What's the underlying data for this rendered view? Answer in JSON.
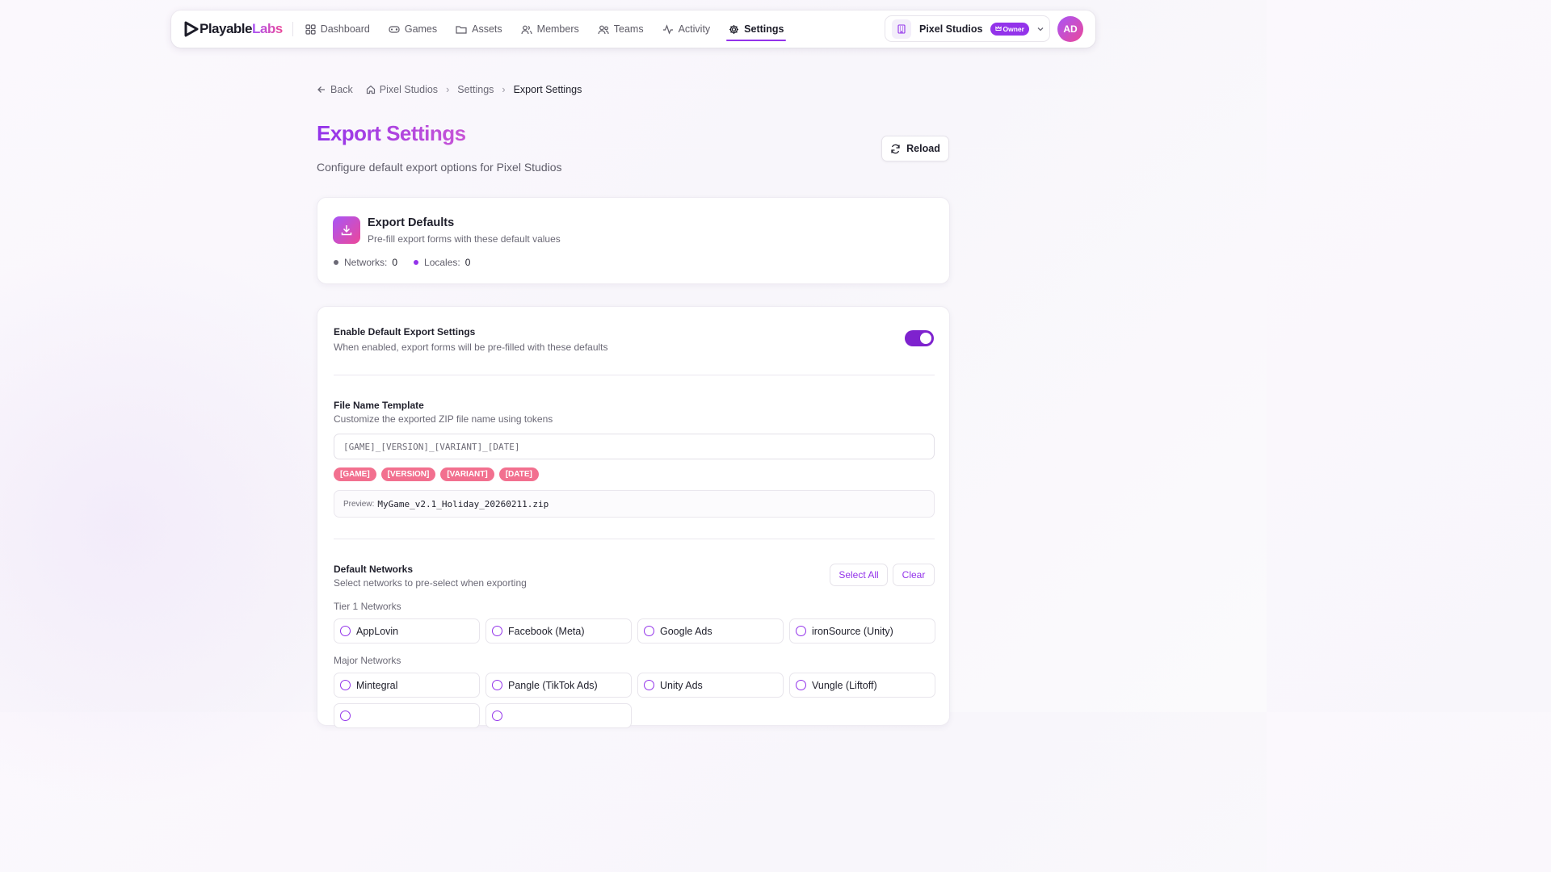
{
  "brand": {
    "part1": "Playable",
    "part2": "Labs"
  },
  "nav": {
    "items": [
      {
        "label": "Dashboard",
        "icon": "dashboard-icon",
        "active": false
      },
      {
        "label": "Games",
        "icon": "gamepad-icon",
        "active": false
      },
      {
        "label": "Assets",
        "icon": "folder-icon",
        "active": false
      },
      {
        "label": "Members",
        "icon": "members-icon",
        "active": false
      },
      {
        "label": "Teams",
        "icon": "teams-icon",
        "active": false
      },
      {
        "label": "Activity",
        "icon": "activity-icon",
        "active": false
      },
      {
        "label": "Settings",
        "icon": "gear-icon",
        "active": true
      }
    ]
  },
  "org": {
    "name": "Pixel Studios",
    "role": "Owner",
    "avatar_initials": "AD"
  },
  "breadcrumb": {
    "back": "Back",
    "items": [
      "Pixel Studios",
      "Settings"
    ],
    "current": "Export Settings"
  },
  "page": {
    "title": "Export Settings",
    "subtitle": "Configure default export options for Pixel Studios",
    "reload": "Reload"
  },
  "defaults_card": {
    "title": "Export Defaults",
    "subtitle": "Pre-fill export forms with these default values",
    "networks_label": "Networks:",
    "networks_count": "0",
    "locales_label": "Locales:",
    "locales_count": "0"
  },
  "enable": {
    "label": "Enable Default Export Settings",
    "description": "When enabled, export forms will be pre-filled with these defaults",
    "enabled": true
  },
  "filename": {
    "label": "File Name Template",
    "description": "Customize the exported ZIP file name using tokens",
    "value": "[GAME]_[VERSION]_[VARIANT]_[DATE]",
    "tokens": [
      "[GAME]",
      "[VERSION]",
      "[VARIANT]",
      "[DATE]"
    ],
    "preview_label": "Preview:",
    "preview_value": "MyGame_v2.1_Holiday_20260211.zip"
  },
  "networks": {
    "label": "Default Networks",
    "description": "Select networks to pre-select when exporting",
    "select_all": "Select All",
    "clear": "Clear",
    "groups": [
      {
        "title": "Tier 1 Networks",
        "items": [
          "AppLovin",
          "Facebook (Meta)",
          "Google Ads",
          "ironSource (Unity)"
        ]
      },
      {
        "title": "Major Networks",
        "items": [
          "Mintegral",
          "Pangle (TikTok Ads)",
          "Unity Ads",
          "Vungle (Liftoff)"
        ]
      }
    ]
  },
  "colors": {
    "accent": "#9333ea",
    "token": "#f2708f",
    "gradient_end": "#ec4899"
  }
}
